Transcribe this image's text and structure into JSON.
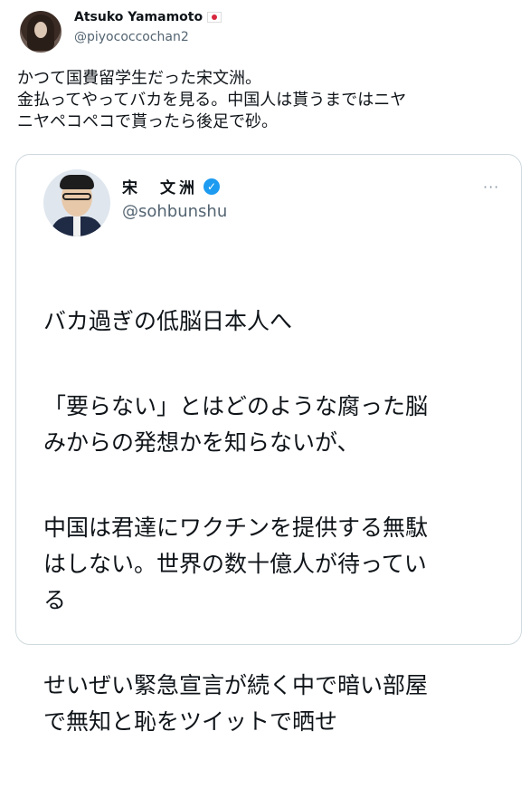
{
  "tweet": {
    "author_name": "Atsuko Yamamoto",
    "author_handle": "@piyococcochan2",
    "flag_icon": "japan-flag-icon",
    "text": "かつて国費留学生だった宋文洲。\n金払ってやってバカを見る。中国人は貰うまではニヤ\nニヤペコペコで貰ったら後足で砂。"
  },
  "quoted_tweet": {
    "author_name": "宋　文洲",
    "author_handle": "@sohbunshu",
    "verified_icon": "verified-badge-icon",
    "more_label": "···",
    "paragraphs": [
      "バカ過ぎの低脳日本人へ",
      "「要らない」とはどのような腐った脳\nみからの発想かを知らないが、",
      "中国は君達にワクチンを提供する無駄\nはしない。世界の数十億人が待ってい\nる",
      "せいぜい緊急宣言が続く中で暗い部屋\nで無知と恥をツイットで晒せ"
    ]
  },
  "colors": {
    "text": "#0f1419",
    "secondary": "#536471",
    "border": "#cfd9de",
    "verified": "#1d9bf0",
    "flag_red": "#d7263d"
  }
}
